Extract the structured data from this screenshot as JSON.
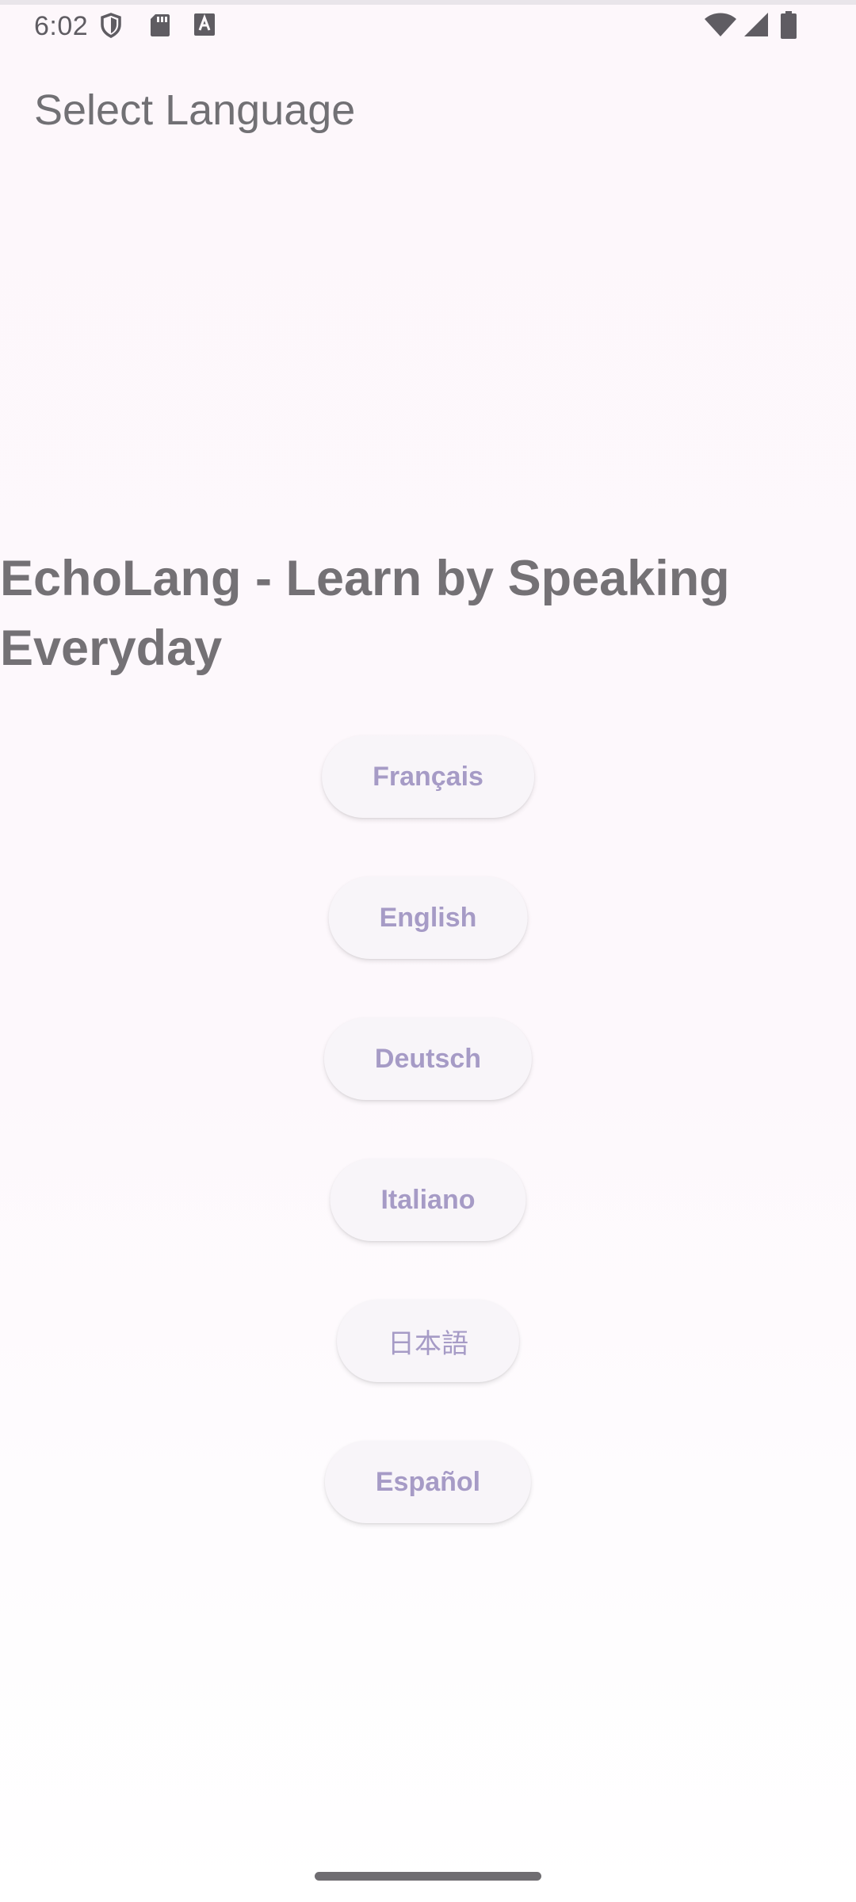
{
  "status_bar": {
    "time": "6:02",
    "left_icons": [
      "shield-icon",
      "sd-card-icon",
      "text-a-icon"
    ],
    "right_icons": [
      "wifi-icon",
      "cell-signal-icon",
      "battery-icon"
    ]
  },
  "app_bar": {
    "title": "Select Language"
  },
  "main": {
    "headline": "EchoLang - Learn by Speaking Everyday",
    "languages": [
      {
        "label": "Français"
      },
      {
        "label": "English"
      },
      {
        "label": "Deutsch"
      },
      {
        "label": "Italiano"
      },
      {
        "label": "日本語"
      },
      {
        "label": "Español"
      }
    ]
  },
  "colors": {
    "background": "#fdf7fb",
    "button_bg": "#f8f5f9",
    "button_text": "#a69bc6",
    "headline": "#747175",
    "title": "#717074"
  }
}
